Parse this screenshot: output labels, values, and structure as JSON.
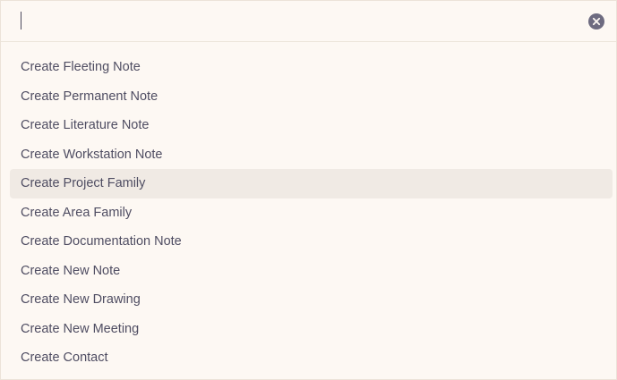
{
  "search": {
    "value": "",
    "placeholder": ""
  },
  "clear_button": {
    "icon": "close-circle-icon"
  },
  "items": [
    {
      "label": "Create Fleeting Note",
      "selected": false
    },
    {
      "label": "Create Permanent Note",
      "selected": false
    },
    {
      "label": "Create Literature Note",
      "selected": false
    },
    {
      "label": "Create Workstation Note",
      "selected": false
    },
    {
      "label": "Create Project Family",
      "selected": true
    },
    {
      "label": "Create Area Family",
      "selected": false
    },
    {
      "label": "Create Documentation Note",
      "selected": false
    },
    {
      "label": "Create New Note",
      "selected": false
    },
    {
      "label": "Create New Drawing",
      "selected": false
    },
    {
      "label": "Create New Meeting",
      "selected": false
    },
    {
      "label": "Create Contact",
      "selected": false
    }
  ],
  "colors": {
    "background": "#fdf8f3",
    "selected_row": "#f0eae4",
    "text": "#4f4d62",
    "clear_icon": "#6e6b80"
  }
}
